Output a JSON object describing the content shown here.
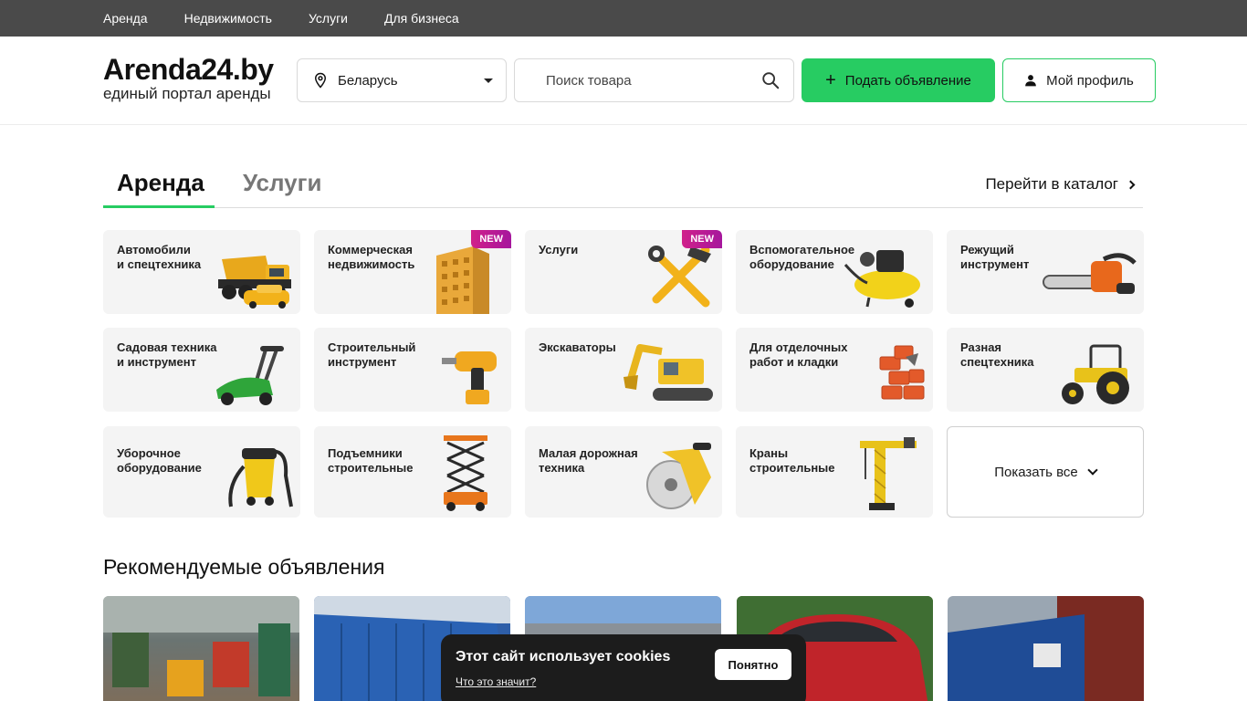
{
  "topnav": {
    "items": [
      {
        "label": "Аренда"
      },
      {
        "label": "Недвижимость"
      },
      {
        "label": "Услуги"
      },
      {
        "label": "Для бизнеса"
      }
    ]
  },
  "header": {
    "logo_title": "Arenda24.by",
    "logo_subtitle": "единый портал аренды",
    "region": "Беларусь",
    "search_placeholder": "Поиск товара",
    "post_button": "Подать объявление",
    "profile_button": "Мой профиль"
  },
  "tabs": {
    "active": "Аренда",
    "inactive": "Услуги",
    "catalog_link": "Перейти в каталог"
  },
  "categories": [
    {
      "title": "Автомобили\nи спецтехника",
      "icon": "dump-truck-icon"
    },
    {
      "title": "Коммерческая\nнедвижимость",
      "icon": "building-icon",
      "badge": "NEW"
    },
    {
      "title": "Услуги",
      "icon": "hammer-wrench-icon",
      "badge": "NEW"
    },
    {
      "title": "Вспомогательное\nоборудование",
      "icon": "compressor-icon"
    },
    {
      "title": "Режущий\nинструмент",
      "icon": "chainsaw-icon"
    },
    {
      "title": "Садовая техника\nи инструмент",
      "icon": "lawnmower-icon"
    },
    {
      "title": "Строительный\nинструмент",
      "icon": "drill-icon"
    },
    {
      "title": "Экскаваторы",
      "icon": "excavator-icon"
    },
    {
      "title": "Для отделочных\nработ и кладки",
      "icon": "bricks-icon"
    },
    {
      "title": "Разная\nспецтехника",
      "icon": "tractor-icon"
    },
    {
      "title": "Уборочное\nоборудование",
      "icon": "vacuum-icon"
    },
    {
      "title": "Подъемники\nстроительные",
      "icon": "scissor-lift-icon"
    },
    {
      "title": "Малая дорожная\nтехника",
      "icon": "road-saw-icon"
    },
    {
      "title": "Краны\nстроительные",
      "icon": "crane-icon"
    }
  ],
  "show_all": "Показать все",
  "recommended": {
    "title": "Рекомендуемые объявления"
  },
  "cookie": {
    "text": "Этот сайт использует cookies",
    "link": "Что это значит?",
    "button": "Понятно"
  },
  "colors": {
    "accent": "#27cc62",
    "topnav_bg": "#4a4a4a",
    "badge": "#c01d92",
    "card_bg": "#f4f4f4"
  }
}
